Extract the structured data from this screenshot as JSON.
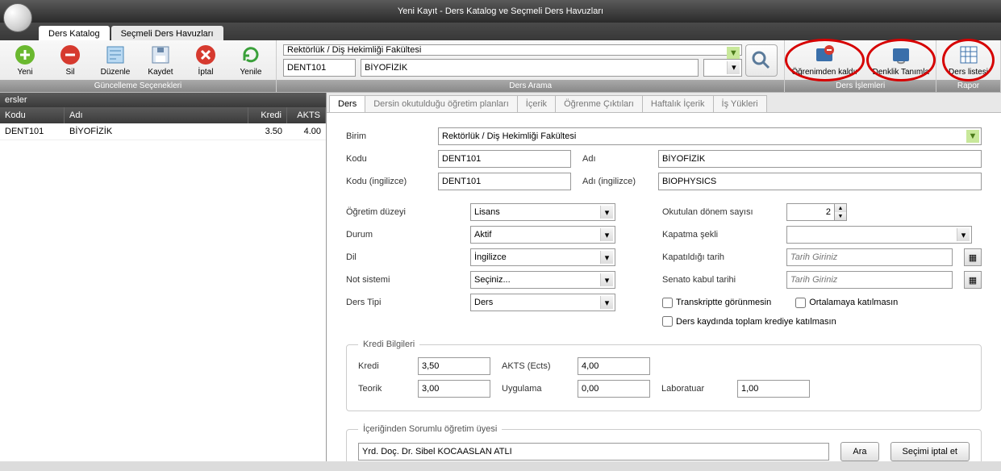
{
  "window_title": "Yeni Kayıt - Ders Katalog ve Seçmeli Ders Havuzları",
  "top_tabs": {
    "active": "Ders Katalog",
    "inactive": "Seçmeli Ders Havuzları"
  },
  "ribbon": {
    "group_update_label": "Güncelleme Seçenekleri",
    "group_search_label": "Ders Arama",
    "group_ops_label": "Ders İşlemleri",
    "group_report_label": "Rapor",
    "yeni": "Yeni",
    "sil": "Sil",
    "duzenle": "Düzenle",
    "kaydet": "Kaydet",
    "iptal": "İptal",
    "yenile": "Yenile",
    "ogrenimden_kaldir": "Öğrenimden kaldır",
    "denklik_tanimla": "Denklik Tanımla",
    "ders_listesi": "Ders listesi",
    "search_birim": "Rektörlük / Diş Hekimliği Fakültesi",
    "search_kod": "DENT101",
    "search_ad": "BİYOFİZİK"
  },
  "left": {
    "title": "ersler",
    "headers": {
      "kodu": "Kodu",
      "adi": "Adı",
      "kredi": "Kredi",
      "akts": "AKTS"
    },
    "row": {
      "kodu": "DENT101",
      "adi": "BİYOFİZİK",
      "kredi": "3.50",
      "akts": "4.00"
    }
  },
  "form_tabs": {
    "t0": "Ders",
    "t1": "Dersin okutulduğu öğretim planları",
    "t2": "İçerik",
    "t3": "Öğrenme Çıktıları",
    "t4": "Haftalık İçerik",
    "t5": "İş Yükleri"
  },
  "form": {
    "labels": {
      "birim": "Birim",
      "kodu": "Kodu",
      "adi": "Adı",
      "kodu_en": "Kodu (ingilizce)",
      "adi_en": "Adı (ingilizce)",
      "ogretim_duzeyi": "Öğretim düzeyi",
      "durum": "Durum",
      "dil": "Dil",
      "not_sistemi": "Not sistemi",
      "ders_tipi": "Ders Tipi",
      "okutulan_donem": "Okutulan dönem sayısı",
      "kapatma_sekli": "Kapatma şekli",
      "kapatildigi_tarih": "Kapatıldığı tarih",
      "senato_tarihi": "Senato kabul tarihi",
      "check_transkript": "Transkriptte görünmesin",
      "check_ortalama": "Ortalamaya katılmasın",
      "check_kredi": "Ders kaydında toplam krediye katılmasın",
      "tarih_placeholder": "Tarih Giriniz"
    },
    "values": {
      "birim": "Rektörlük / Diş Hekimliği Fakültesi",
      "kodu": "DENT101",
      "adi": "BİYOFİZİK",
      "kodu_en": "DENT101",
      "adi_en": "BIOPHYSICS",
      "ogretim_duzeyi": "Lisans",
      "durum": "Aktif",
      "dil": "İngilizce",
      "not_sistemi": "Seçiniz...",
      "ders_tipi": "Ders",
      "okutulan_donem": "2",
      "kapatma_sekli": ""
    },
    "kredi": {
      "legend": "Kredi Bilgileri",
      "labels": {
        "kredi": "Kredi",
        "akts": "AKTS (Ects)",
        "teorik": "Teorik",
        "uygulama": "Uygulama",
        "laboratuar": "Laboratuar"
      },
      "values": {
        "kredi": "3,50",
        "akts": "4,00",
        "teorik": "3,00",
        "uygulama": "0,00",
        "laboratuar": "1,00"
      }
    },
    "instructor": {
      "legend": "İçeriğinden Sorumlu öğretim üyesi",
      "value": "Yrd. Doç. Dr. Sibel KOCAASLAN ATLI",
      "btn_search": "Ara",
      "btn_cancel": "Seçimi iptal et"
    }
  },
  "chart_data": {
    "type": "table",
    "headers": [
      "Kodu",
      "Adı",
      "Kredi",
      "AKTS"
    ],
    "rows": [
      [
        "DENT101",
        "BİYOFİZİK",
        3.5,
        4.0
      ]
    ]
  }
}
